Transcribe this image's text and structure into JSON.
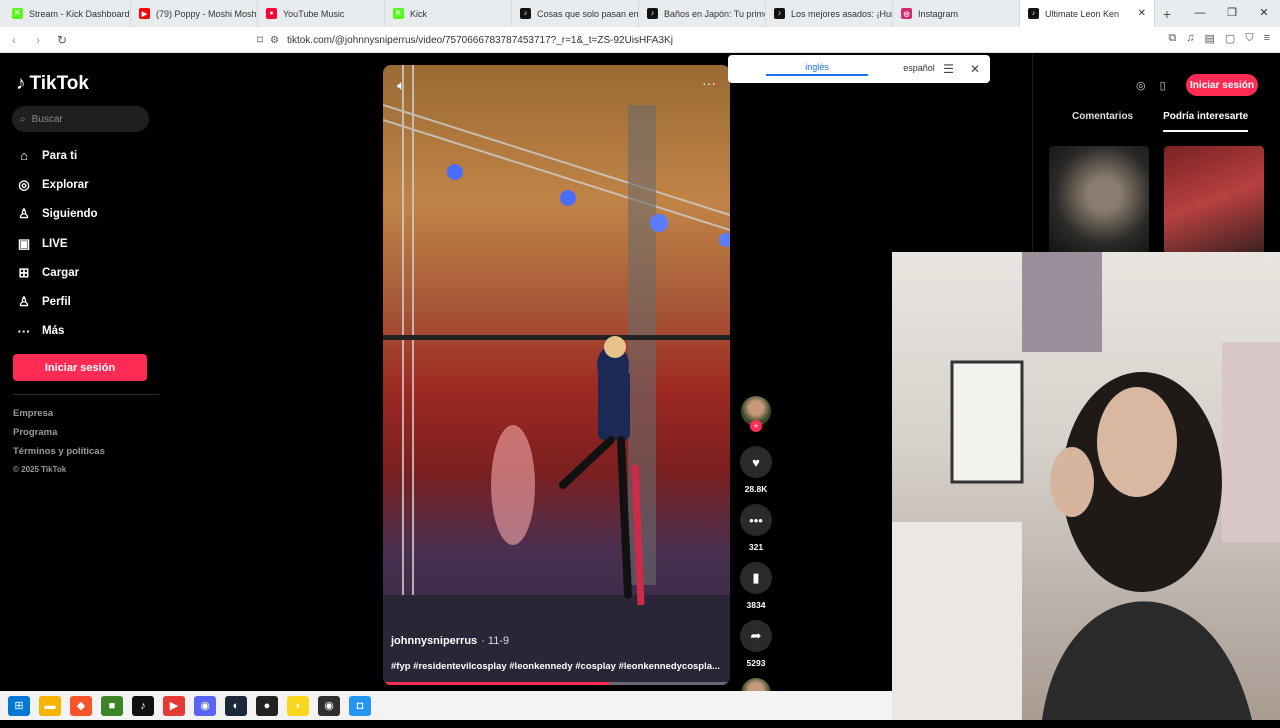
{
  "browser": {
    "tabs": [
      {
        "label": "Stream - Kick Dashboard",
        "color": "#53fc18",
        "glyph": "K"
      },
      {
        "label": "(79) Poppy - Moshi Moshi",
        "color": "#ff0000",
        "glyph": "▶"
      },
      {
        "label": "YouTube Music",
        "color": "#ff0033",
        "glyph": "●"
      },
      {
        "label": "Kick",
        "color": "#53fc18",
        "glyph": "K"
      },
      {
        "label": "Cosas que solo pasan en Ï",
        "color": "#111111",
        "glyph": "♪"
      },
      {
        "label": "Baños en Japón: Tu primer",
        "color": "#111111",
        "glyph": "♪"
      },
      {
        "label": "Los mejores asados: ¡Hum",
        "color": "#111111",
        "glyph": "♪"
      },
      {
        "label": "Instagram",
        "color": "#d62976",
        "glyph": "◎"
      },
      {
        "label": "Ultimate Leon Ken",
        "color": "#111111",
        "glyph": "♪",
        "active": true
      }
    ],
    "url": "tiktok.com/@johnnysniperrus/video/7570666783787453717?_r=1&_t=ZS-92UisHFA3Kj"
  },
  "translate_bar": {
    "source_lang": "inglés",
    "target_lang": "español"
  },
  "sidebar": {
    "logo": "TikTok",
    "search_placeholder": "Buscar",
    "nav": [
      {
        "label": "Para ti",
        "icon": "home-icon",
        "glyph": "⌂"
      },
      {
        "label": "Explorar",
        "icon": "compass-icon",
        "glyph": "◎"
      },
      {
        "label": "Siguiendo",
        "icon": "following-icon",
        "glyph": "♙"
      },
      {
        "label": "LIVE",
        "icon": "live-icon",
        "glyph": "▣"
      },
      {
        "label": "Cargar",
        "icon": "upload-icon",
        "glyph": "⊞"
      },
      {
        "label": "Perfil",
        "icon": "profile-icon",
        "glyph": "♙"
      },
      {
        "label": "Más",
        "icon": "more-icon",
        "glyph": "···"
      }
    ],
    "login_label": "Iniciar sesión",
    "footer": [
      "Empresa",
      "Programa",
      "Términos y políticas"
    ],
    "copyright": "© 2025 TikTok"
  },
  "video": {
    "author": "johnnysniperrus",
    "date": "· 11-9",
    "caption": "#fyp #residentevilcosplay #leonkennedy #cosplay #leonkennedycospla...",
    "progress": 0.65,
    "likes": "28.8K",
    "comments": "321",
    "saves": "3834",
    "shares": "5293"
  },
  "right_panel": {
    "login_label": "Iniciar sesión",
    "tab_comments": "Comentarios",
    "tab_recommended": "Podría interesarte"
  },
  "taskbar": {
    "apps": [
      {
        "name": "windows-start-icon",
        "color": "#0078d4",
        "glyph": "⊞"
      },
      {
        "name": "file-explorer-icon",
        "color": "#f4b400",
        "glyph": "▬"
      },
      {
        "name": "brave-icon",
        "color": "#fb542b",
        "glyph": "◆"
      },
      {
        "name": "minecraft-icon",
        "color": "#3c8527",
        "glyph": "■"
      },
      {
        "name": "tiktok-icon",
        "color": "#111111",
        "glyph": "♪"
      },
      {
        "name": "app-red-icon",
        "color": "#e53935",
        "glyph": "▶"
      },
      {
        "name": "discord-icon",
        "color": "#5865f2",
        "glyph": "◉"
      },
      {
        "name": "steam-icon",
        "color": "#1b2838",
        "glyph": "◐"
      },
      {
        "name": "app-dark-icon",
        "color": "#222222",
        "glyph": "●"
      },
      {
        "name": "app-yellow-icon",
        "color": "#f9d71c",
        "glyph": "◗"
      },
      {
        "name": "obs-icon",
        "color": "#302e31",
        "glyph": "◉"
      },
      {
        "name": "app-blue-icon",
        "color": "#2196f3",
        "glyph": "◘"
      }
    ]
  }
}
